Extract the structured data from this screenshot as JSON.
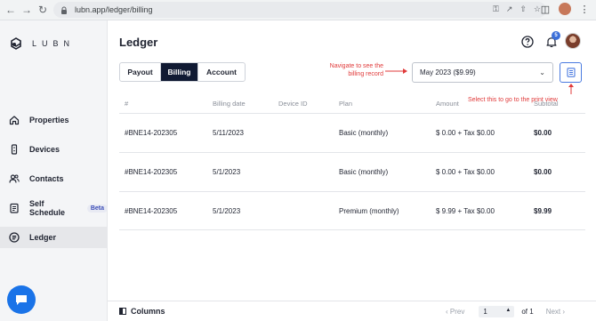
{
  "browser": {
    "url": "lubn.app/ledger/billing"
  },
  "sidebar": {
    "logo_text": "LUBN",
    "items": [
      {
        "label": "Properties",
        "icon": "home-icon"
      },
      {
        "label": "Devices",
        "icon": "device-icon"
      },
      {
        "label": "Contacts",
        "icon": "people-icon"
      },
      {
        "label": "Self Schedule",
        "icon": "calendar-icon",
        "badge": "Beta"
      },
      {
        "label": "Ledger",
        "icon": "ledger-icon",
        "active": true
      }
    ]
  },
  "header": {
    "title": "Ledger",
    "notification_count": "5"
  },
  "tabs": [
    {
      "label": "Payout",
      "active": false
    },
    {
      "label": "Billing",
      "active": true
    },
    {
      "label": "Account",
      "active": false
    }
  ],
  "annotations": {
    "navigate": "Navigate to see the billing record",
    "print": "Select this to go to the print view"
  },
  "period_select": {
    "value": "May 2023 ($9.99)"
  },
  "table": {
    "columns": [
      "#",
      "Billing date",
      "Device ID",
      "Plan",
      "Amount",
      "Subtotal"
    ],
    "rows": [
      {
        "id": "#BNE14-202305",
        "date": "5/11/2023",
        "device": "",
        "plan": "Basic (monthly)",
        "amount": "$ 0.00 + Tax $0.00",
        "subtotal": "$0.00"
      },
      {
        "id": "#BNE14-202305",
        "date": "5/1/2023",
        "device": "",
        "plan": "Basic (monthly)",
        "amount": "$ 0.00 + Tax $0.00",
        "subtotal": "$0.00"
      },
      {
        "id": "#BNE14-202305",
        "date": "5/1/2023",
        "device": "",
        "plan": "Premium (monthly)",
        "amount": "$ 9.99 + Tax $0.00",
        "subtotal": "$9.99"
      }
    ]
  },
  "footer": {
    "columns_label": "Columns",
    "prev_label": "Prev",
    "page_value": "1",
    "of_label": "of 1",
    "next_label": "Next"
  },
  "colors": {
    "accent": "#101a33",
    "annotation": "#e03a3a",
    "link_blue": "#4a7ae0"
  }
}
